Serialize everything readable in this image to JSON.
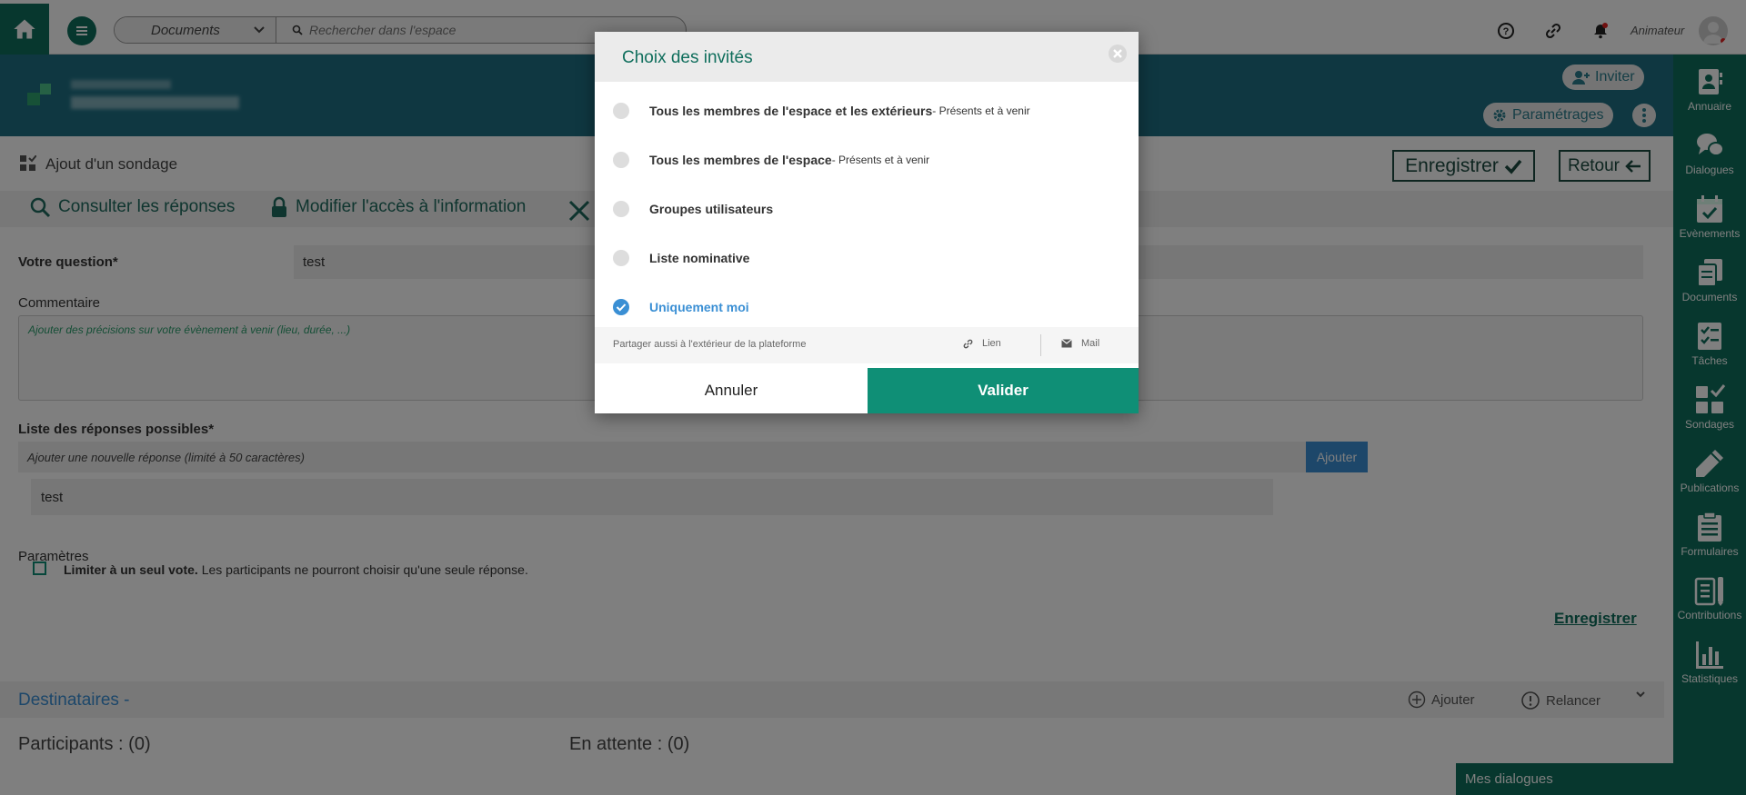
{
  "colors": {
    "brand_green": "#0f6e5c",
    "banner_teal": "#1e6f83",
    "accent_blue": "#3a8fd4",
    "validate_green": "#0f8f76"
  },
  "topbar": {
    "search_scope": "Documents",
    "search_placeholder": "Rechercher dans l'espace",
    "user_role": "Animateur",
    "icons": [
      "home-icon",
      "menu-icon",
      "help-icon",
      "link-icon",
      "bell-icon"
    ]
  },
  "banner": {
    "invite_label": "Inviter",
    "settings_label": "Paramétrages"
  },
  "page": {
    "title": "Ajout d'un sondage",
    "save_button": "Enregistrer",
    "back_button": "Retour",
    "tabs": [
      "Consulter les réponses",
      "Modifier l'accès à l'information"
    ]
  },
  "form": {
    "question_label": "Votre question*",
    "question_value": "test",
    "comment_label": "Commentaire",
    "comment_placeholder": "Ajouter des précisions sur votre évènement à venir (lieu, durée, ...)",
    "answers_label": "Liste des réponses possibles*",
    "answer_placeholder": "Ajouter une nouvelle réponse (limité à 50 caractères)",
    "add_button": "Ajouter",
    "answers": [
      "test"
    ],
    "params_label": "Paramètres",
    "limit_vote_bold": "Limiter à un seul vote.",
    "limit_vote_text": "Les participants ne pourront choisir qu'une seule réponse.",
    "save_link": "Enregistrer"
  },
  "recipients": {
    "title": "Destinataires -",
    "add_label": "Ajouter",
    "remind_label": "Relancer",
    "participants": "Participants : (0)",
    "pending": "En attente : (0)"
  },
  "chat": {
    "title": "Mes dialogues"
  },
  "sidebar": {
    "items": [
      {
        "label": "Annuaire",
        "icon": "directory-icon"
      },
      {
        "label": "Dialogues",
        "icon": "dialogues-icon"
      },
      {
        "label": "Evènements",
        "icon": "calendar-icon"
      },
      {
        "label": "Documents",
        "icon": "documents-icon"
      },
      {
        "label": "Tâches",
        "icon": "tasks-icon"
      },
      {
        "label": "Sondages",
        "icon": "polls-icon"
      },
      {
        "label": "Publications",
        "icon": "pencil-icon"
      },
      {
        "label": "Formulaires",
        "icon": "forms-icon"
      },
      {
        "label": "Contributions",
        "icon": "contributions-icon"
      },
      {
        "label": "Statistiques",
        "icon": "stats-icon"
      }
    ]
  },
  "modal": {
    "title": "Choix des invités",
    "options": [
      {
        "label": "Tous les membres de l'espace et les extérieurs",
        "suffix": " - Présents et à venir",
        "selected": false
      },
      {
        "label": "Tous les membres de l'espace",
        "suffix": " - Présents et à venir",
        "selected": false
      },
      {
        "label": "Groupes utilisateurs",
        "suffix": "",
        "selected": false
      },
      {
        "label": "Liste nominative",
        "suffix": "",
        "selected": false
      },
      {
        "label": "Uniquement moi",
        "suffix": "",
        "selected": true
      }
    ],
    "share_text": "Partager aussi à l'extérieur de la plateforme",
    "share_link": "Lien",
    "share_mail": "Mail",
    "cancel": "Annuler",
    "validate": "Valider"
  }
}
